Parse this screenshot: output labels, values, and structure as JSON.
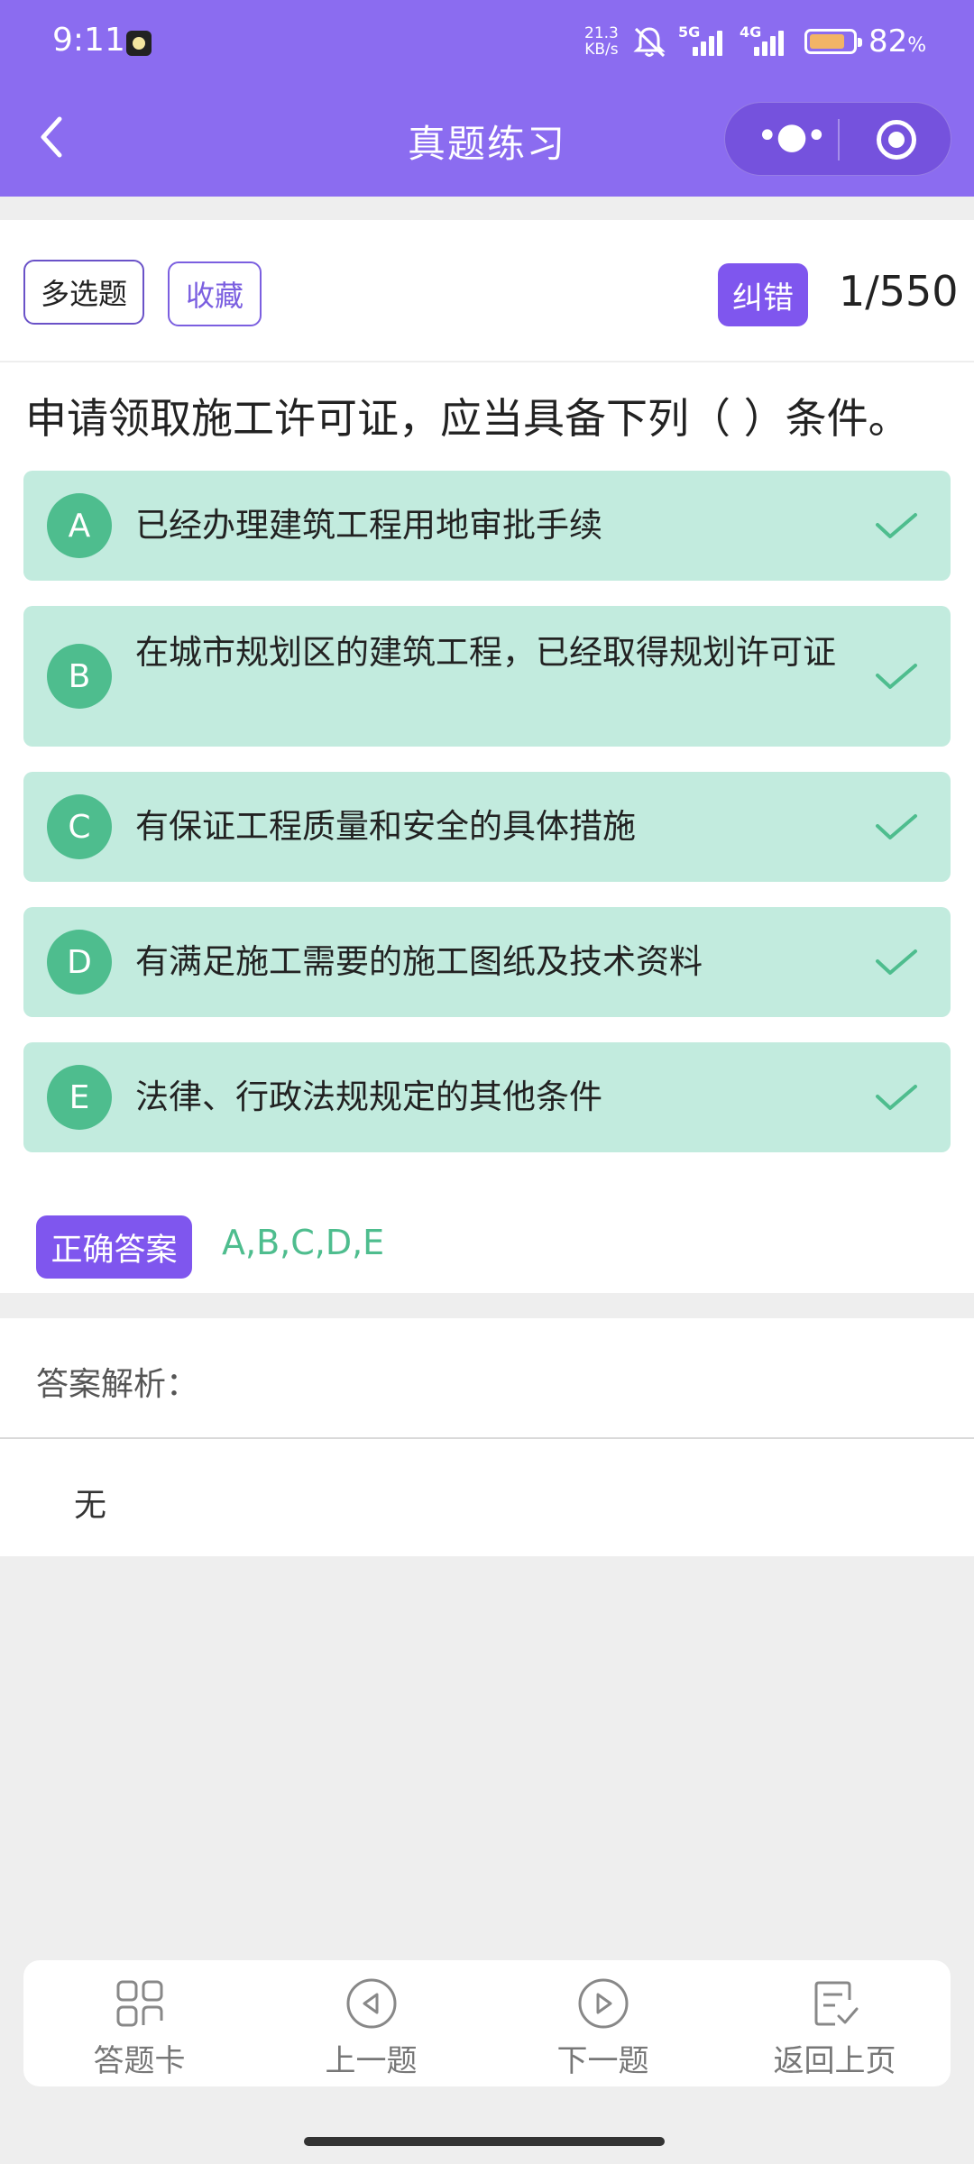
{
  "status_bar": {
    "time": "9:11",
    "net_speed_value": "21.3",
    "net_speed_unit": "KB/s",
    "network_1": "5G",
    "network_2": "4G",
    "battery_percent": "82",
    "battery_unit": "%",
    "battery_level": 0.82
  },
  "header": {
    "title": "真题练习",
    "back_icon": "chevron-left-icon",
    "more_icon": "more-dots-icon",
    "close_icon": "target-circle-icon",
    "background_color": "#8b6cf0"
  },
  "question_card": {
    "type_tag": "多选题",
    "favorite_label": "收藏",
    "report_label": "纠错",
    "progress": "1/550",
    "question_text": "申请领取施工许可证，应当具备下列（ ）条件。",
    "options": [
      {
        "letter": "A",
        "text": "已经办理建筑工程用地审批手续",
        "selected": true
      },
      {
        "letter": "B",
        "text": "在城市规划区的建筑工程，已经取得规划许可证",
        "selected": true
      },
      {
        "letter": "C",
        "text": "有保证工程质量和安全的具体措施",
        "selected": true
      },
      {
        "letter": "D",
        "text": "有满足施工需要的施工图纸及技术资料",
        "selected": true
      },
      {
        "letter": "E",
        "text": "法律、行政法规规定的其他条件",
        "selected": true
      }
    ],
    "correct_answer_label": "正确答案",
    "correct_answer": "A,B,C,D,E",
    "accent_color": "#7f56ee",
    "correct_color": "#4ebd8e",
    "option_background": "#c2ebde"
  },
  "analysis": {
    "title": "答案解析：",
    "body": "无"
  },
  "bottom_nav": [
    {
      "label": "答题卡",
      "icon": "grid-icon"
    },
    {
      "label": "上一题",
      "icon": "previous-circle-icon"
    },
    {
      "label": "下一题",
      "icon": "next-circle-icon"
    },
    {
      "label": "返回上页",
      "icon": "return-checklist-icon"
    }
  ]
}
